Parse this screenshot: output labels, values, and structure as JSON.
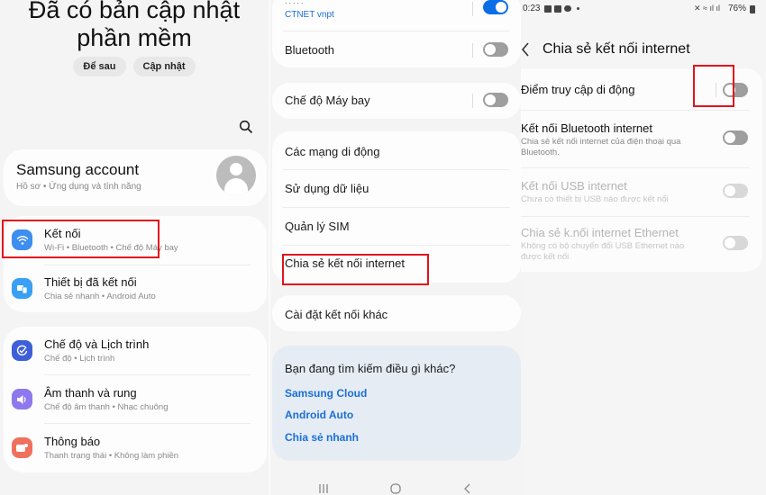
{
  "screen1": {
    "update_title_line1": "Đã có bản cập nhật",
    "update_title_line2": "phần mềm",
    "later_button": "Để sau",
    "update_button": "Cập nhật",
    "search_icon": "search-icon",
    "account": {
      "title": "Samsung account",
      "subtitle": "Hồ sơ  •  Ứng dụng và tính năng"
    },
    "items": [
      {
        "title": "Kết nối",
        "subtitle": "Wi-Fi  •  Bluetooth  •  Chế độ Máy bay",
        "icon": "wifi-icon",
        "color": "#3d8ef0"
      },
      {
        "title": "Thiết bị đã kết nối",
        "subtitle": "Chia sẻ nhanh  •  Android Auto",
        "icon": "devices-icon",
        "color": "#3aa0f3"
      },
      {
        "title": "Chế độ và Lịch trình",
        "subtitle": "Chế độ  •  Lịch trình",
        "icon": "check-circle-icon",
        "color": "#3e5fd9"
      },
      {
        "title": "Âm thanh và rung",
        "subtitle": "Chế độ âm thanh  •  Nhạc chuông",
        "icon": "speaker-icon",
        "color": "#8e78ee"
      },
      {
        "title": "Thông báo",
        "subtitle": "Thanh trạng thái  •  Không làm phiền",
        "icon": "notification-icon",
        "color": "#f0705e"
      }
    ]
  },
  "screen2": {
    "wifi_network": "CTNET vnpt",
    "wifi_on": true,
    "bluetooth": {
      "label": "Bluetooth",
      "on": false
    },
    "airplane": {
      "label": "Chế độ Máy bay",
      "on": false
    },
    "menu": [
      "Các mạng di động",
      "Sử dụng dữ liệu",
      "Quản lý SIM",
      "Chia sẻ kết nối internet"
    ],
    "other_settings": "Cài đặt kết nối khác",
    "suggest_title": "Bạn đang tìm kiếm điều gì khác?",
    "links": [
      "Samsung Cloud",
      "Android Auto",
      "Chia sẻ nhanh"
    ]
  },
  "screen3": {
    "time": "0:23",
    "battery": "76%",
    "title": "Chia sẻ kết nối internet",
    "rows": [
      {
        "title": "Điểm truy cập di động",
        "subtitle": "",
        "on": false,
        "enabled": true
      },
      {
        "title": "Kết nối Bluetooth internet",
        "subtitle": "Chia sẻ kết nối internet của điện thoại qua Bluetooth.",
        "on": false,
        "enabled": true
      },
      {
        "title": "Kết nối USB internet",
        "subtitle": "Chưa có thiết bị USB nào được kết nối",
        "on": false,
        "enabled": false
      },
      {
        "title": "Chia sẻ k.nối internet Ethernet",
        "subtitle": "Không có bộ chuyển đổi USB Ethernet nào được kết nối",
        "on": false,
        "enabled": false
      }
    ]
  },
  "colors": {
    "accent": "#0b6ee6",
    "link": "#1a6fd6",
    "highlight": "#e0141e"
  }
}
